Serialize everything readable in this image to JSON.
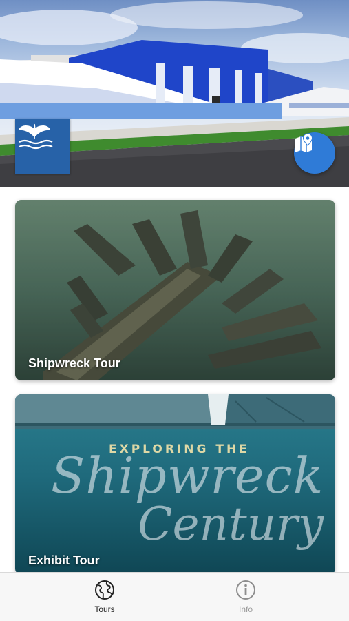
{
  "hero": {
    "logo_icon": "whale-tail-logo",
    "map_button_icon": "map-pin-icon",
    "colors": {
      "building": "#1f45c9",
      "logo_bg": "#2762a8",
      "fab": "#2f7bd7"
    }
  },
  "cards": [
    {
      "title": "Shipwreck Tour"
    },
    {
      "title": "Exhibit Tour",
      "art_text": {
        "line1": "EXPLORING THE",
        "line2": "Shipwreck",
        "line3": "Century"
      }
    }
  ],
  "tabbar": {
    "tabs": [
      {
        "label": "Tours",
        "icon": "globe-icon",
        "active": true
      },
      {
        "label": "Info",
        "icon": "info-icon",
        "active": false
      }
    ]
  }
}
